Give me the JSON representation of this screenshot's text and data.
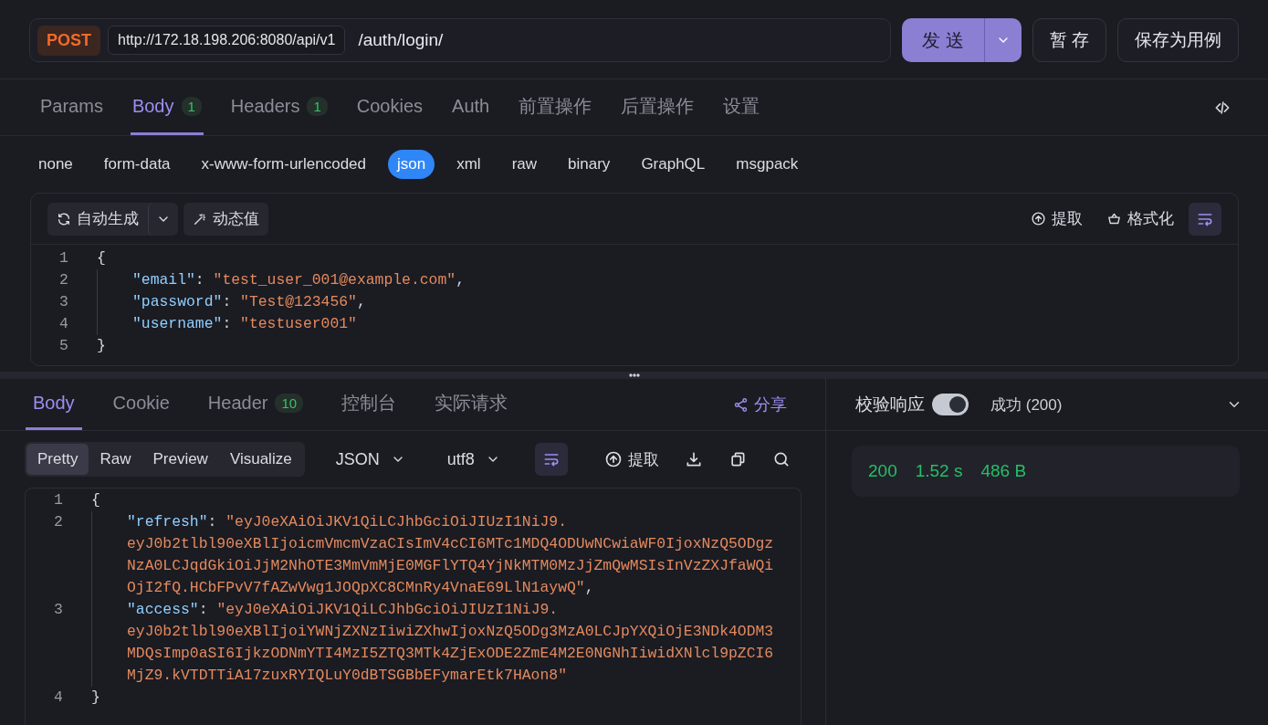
{
  "request": {
    "method": "POST",
    "base_url": "http://172.18.198.206:8080/api/v1",
    "path": "/auth/login/",
    "send": "发 送",
    "save_draft": "暂 存",
    "save_case": "保存为用例"
  },
  "request_tabs": [
    {
      "label": "Params",
      "selected": false
    },
    {
      "label": "Body",
      "badge": "1",
      "selected": true
    },
    {
      "label": "Headers",
      "badge": "1",
      "selected": false
    },
    {
      "label": "Cookies",
      "selected": false
    },
    {
      "label": "Auth",
      "selected": false
    },
    {
      "label": "前置操作",
      "selected": false
    },
    {
      "label": "后置操作",
      "selected": false
    },
    {
      "label": "设置",
      "selected": false
    }
  ],
  "body_types": [
    {
      "label": "none",
      "selected": false
    },
    {
      "label": "form-data",
      "selected": false
    },
    {
      "label": "x-www-form-urlencoded",
      "selected": false
    },
    {
      "label": "json",
      "selected": true
    },
    {
      "label": "xml",
      "selected": false
    },
    {
      "label": "raw",
      "selected": false
    },
    {
      "label": "binary",
      "selected": false
    },
    {
      "label": "GraphQL",
      "selected": false
    },
    {
      "label": "msgpack",
      "selected": false
    }
  ],
  "editor_toolbar": {
    "generate": "自动生成",
    "dynamic": "动态值",
    "extract": "提取",
    "format": "格式化"
  },
  "request_code": [
    {
      "number": "1",
      "text": "{"
    },
    {
      "number": "2",
      "key": "\"email\"",
      "separator": ":",
      "value": [
        "\"test_user_001@example.com\""
      ],
      "trailing": ","
    },
    {
      "number": "3",
      "key": "\"password\"",
      "separator": ":",
      "value": [
        "\"Test@123456\""
      ],
      "trailing": ","
    },
    {
      "number": "4",
      "key": "\"username\"",
      "separator": ":",
      "value": [
        "\"testuser001\""
      ]
    },
    {
      "number": "5",
      "text": "}"
    }
  ],
  "response_tabs": [
    {
      "label": "Body",
      "selected": true
    },
    {
      "label": "Cookie",
      "selected": false
    },
    {
      "label": "Header",
      "badge": "10",
      "selected": false
    },
    {
      "label": "控制台",
      "selected": false
    },
    {
      "label": "实际请求",
      "selected": false
    }
  ],
  "share": "分享",
  "view_modes": [
    {
      "label": "Pretty",
      "selected": true
    },
    {
      "label": "Raw",
      "selected": false
    },
    {
      "label": "Preview",
      "selected": false
    },
    {
      "label": "Visualize",
      "selected": false
    }
  ],
  "format": "JSON",
  "encoding": "utf8",
  "extract": "提取",
  "response_code": [
    {
      "number": "1",
      "text": "{"
    },
    {
      "number": "2",
      "key": "\"refresh\"",
      "separator": ":",
      "value": [
        "\"eyJ0eXAiOiJKV1QiLCJhbGciOiJIUzI1NiJ9.",
        "eyJ0b2tlbl90eXBlIjoicmVmcmVzaCIsImV4cCI6MTc1MDQ4ODUwNCwiaWF0IjoxNzQ5ODgz",
        "NzA0LCJqdGkiOiJjM2NhOTE3MmVmMjE0MGFlYTQ4YjNkMTM0MzJjZmQwMSIsInVzZXJfaWQi",
        "OjI2fQ.HCbFPvV7fAZwVwg1JOQpXC8CMnRy4VnaE69LlN1aywQ\""
      ],
      "trailing": ","
    },
    {
      "number": "3",
      "key": "\"access\"",
      "separator": ":",
      "value": [
        "\"eyJ0eXAiOiJKV1QiLCJhbGciOiJIUzI1NiJ9.",
        "eyJ0b2tlbl90eXBlIjoiYWNjZXNzIiwiZXhwIjoxNzQ5ODg3MzA0LCJpYXQiOjE3NDk4ODM3",
        "MDQsImp0aSI6IjkzODNmYTI4MzI5ZTQ3MTk4ZjExODE2ZmE4M2E0NGNhIiwidXNlcl9pZCI6",
        "MjZ9.kVTDTTiA17zuxRYIQLuY0dBTSGBbEFymarEtk7HAon8\""
      ]
    },
    {
      "number": "4",
      "text": "}"
    }
  ],
  "validation": {
    "label": "校验响应",
    "on": true,
    "result": "成功 (200)"
  },
  "stats": {
    "status": "200",
    "time": "1.52 s",
    "size": "486 B"
  }
}
